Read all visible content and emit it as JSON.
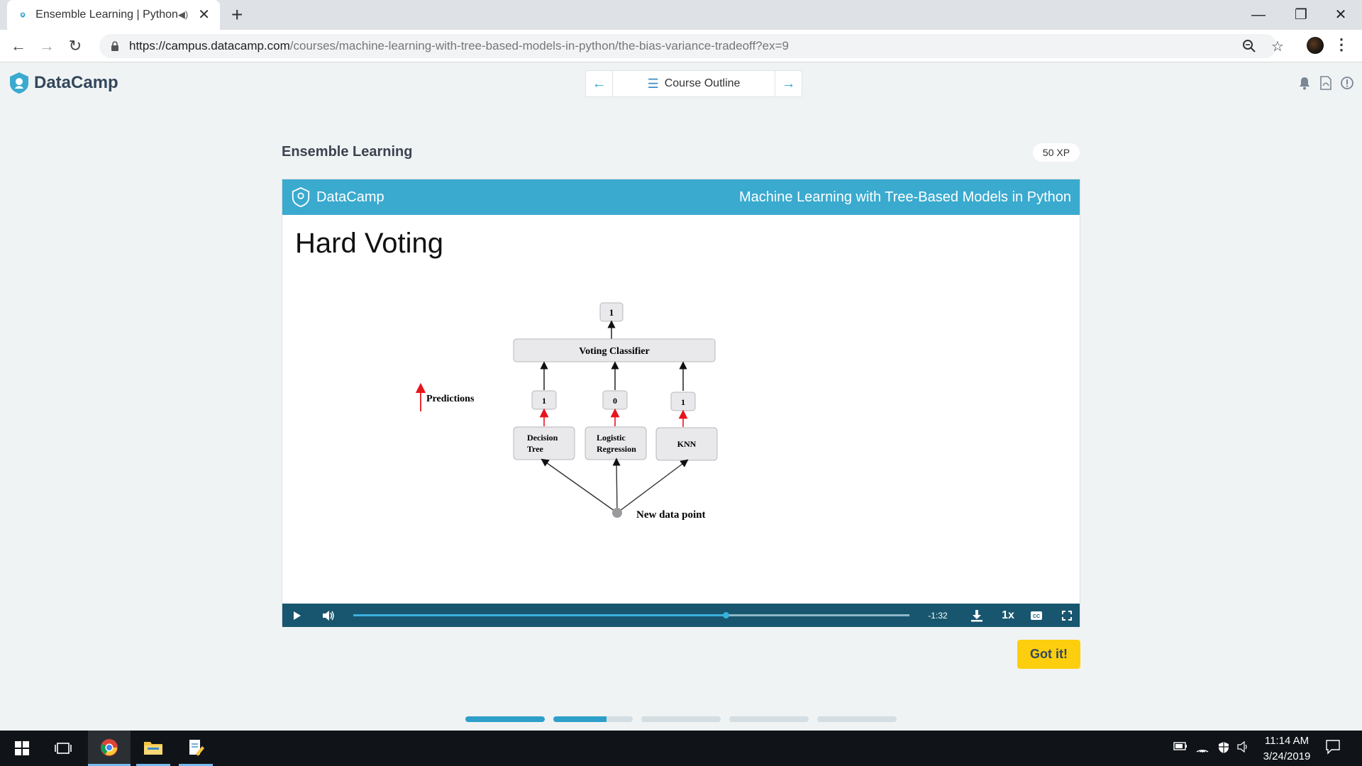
{
  "browser": {
    "tab_title": "Ensemble Learning | Python",
    "new_tab_icon": "+",
    "url_host": "https://campus.datacamp.com",
    "url_path": "/courses/machine-learning-with-tree-based-models-in-python/the-bias-variance-tradeoff?ex=9"
  },
  "header": {
    "brand": "DataCamp",
    "course_outline_label": "Course Outline"
  },
  "exercise": {
    "title": "Ensemble Learning",
    "xp": "50 XP",
    "got_it_label": "Got it!"
  },
  "slide": {
    "brand": "DataCamp",
    "course_name": "Machine Learning with Tree-Based Models in Python",
    "title": "Hard Voting",
    "diagram": {
      "final_prediction": "1",
      "voting_label": "Voting Classifier",
      "legend_label": "Predictions",
      "models": [
        {
          "line1": "Decision",
          "line2": "Tree",
          "prediction": "1"
        },
        {
          "line1": "Logistic",
          "line2": "Regression",
          "prediction": "0"
        },
        {
          "line1": "KNN",
          "line2": "",
          "prediction": "1"
        }
      ],
      "data_point_label": "New data point"
    }
  },
  "player": {
    "time_remaining": "-1:32",
    "speed": "1x",
    "progress": 0.67
  },
  "chapter_progress": [
    1.0,
    0.67,
    0,
    0,
    0
  ],
  "taskbar": {
    "time": "11:14 AM",
    "date": "3/24/2019"
  },
  "colors": {
    "brand_blue": "#3aaacf",
    "player_bg": "#18566f",
    "got_it": "#fcce0d",
    "prediction_arrow": "#e8141c"
  }
}
